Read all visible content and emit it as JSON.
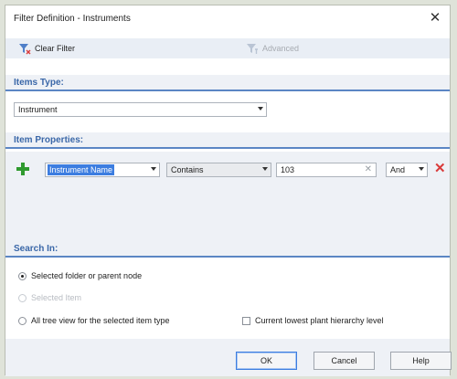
{
  "window": {
    "title": "Filter Definition - Instruments",
    "close_glyph": "✕"
  },
  "toolbar": {
    "clear_filter": "Clear Filter",
    "advanced": "Advanced"
  },
  "items_type": {
    "heading": "Items Type:",
    "selected": "Instrument"
  },
  "item_properties": {
    "heading": "Item Properties:",
    "row": {
      "property": "Instrument Name",
      "operator": "Contains",
      "value": "103",
      "conjunction": "And"
    }
  },
  "search_in": {
    "heading": "Search In:",
    "options": [
      {
        "label": "Selected folder or parent node",
        "checked": true,
        "enabled": true
      },
      {
        "label": "Selected Item",
        "checked": false,
        "enabled": false
      },
      {
        "label": "All tree view for the selected item type",
        "checked": false,
        "enabled": true
      }
    ],
    "checkbox_label": "Current lowest plant hierarchy level",
    "checkbox_checked": false
  },
  "buttons": {
    "ok": "OK",
    "cancel": "Cancel",
    "help": "Help"
  },
  "colors": {
    "accent": "#3c7de0",
    "section_title": "#3a67a8",
    "add_icon": "#2f9a2f",
    "delete_icon": "#d93a3a"
  }
}
